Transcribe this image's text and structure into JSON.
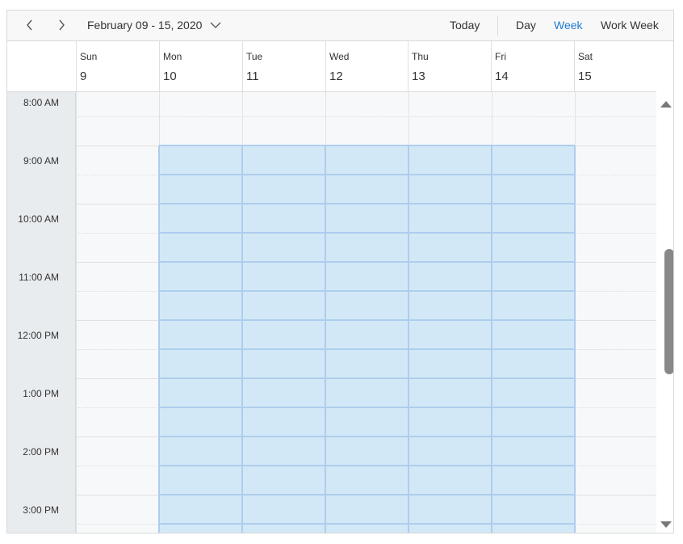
{
  "toolbar": {
    "prev_icon": "chevron-left-icon",
    "next_icon": "chevron-right-icon",
    "date_range": "February 09 - 15, 2020",
    "date_caret_icon": "chevron-down-icon",
    "today_label": "Today",
    "views": [
      {
        "label": "Day",
        "active": false
      },
      {
        "label": "Week",
        "active": true
      },
      {
        "label": "Work Week",
        "active": false
      }
    ]
  },
  "days": [
    {
      "name": "Sun",
      "num": "9",
      "work": false
    },
    {
      "name": "Mon",
      "num": "10",
      "work": true
    },
    {
      "name": "Tue",
      "num": "11",
      "work": true
    },
    {
      "name": "Wed",
      "num": "12",
      "work": true
    },
    {
      "name": "Thu",
      "num": "13",
      "work": true
    },
    {
      "name": "Fri",
      "num": "14",
      "work": true
    },
    {
      "name": "Sat",
      "num": "15",
      "work": false
    }
  ],
  "times": [
    "8:00 AM",
    "9:00 AM",
    "10:00 AM",
    "11:00 AM",
    "12:00 PM",
    "1:00 PM",
    "2:00 PM",
    "3:00 PM"
  ],
  "work_hours_start_index": 1,
  "colors": {
    "accent": "#1f7bd6",
    "work_cell": "#d3e8f6",
    "work_border": "#aecdee",
    "off_cell": "#f7f8f9",
    "time_column": "#e9ecef"
  },
  "scrollbar": {
    "up_icon": "triangle-up-icon",
    "down_icon": "triangle-down-icon"
  }
}
